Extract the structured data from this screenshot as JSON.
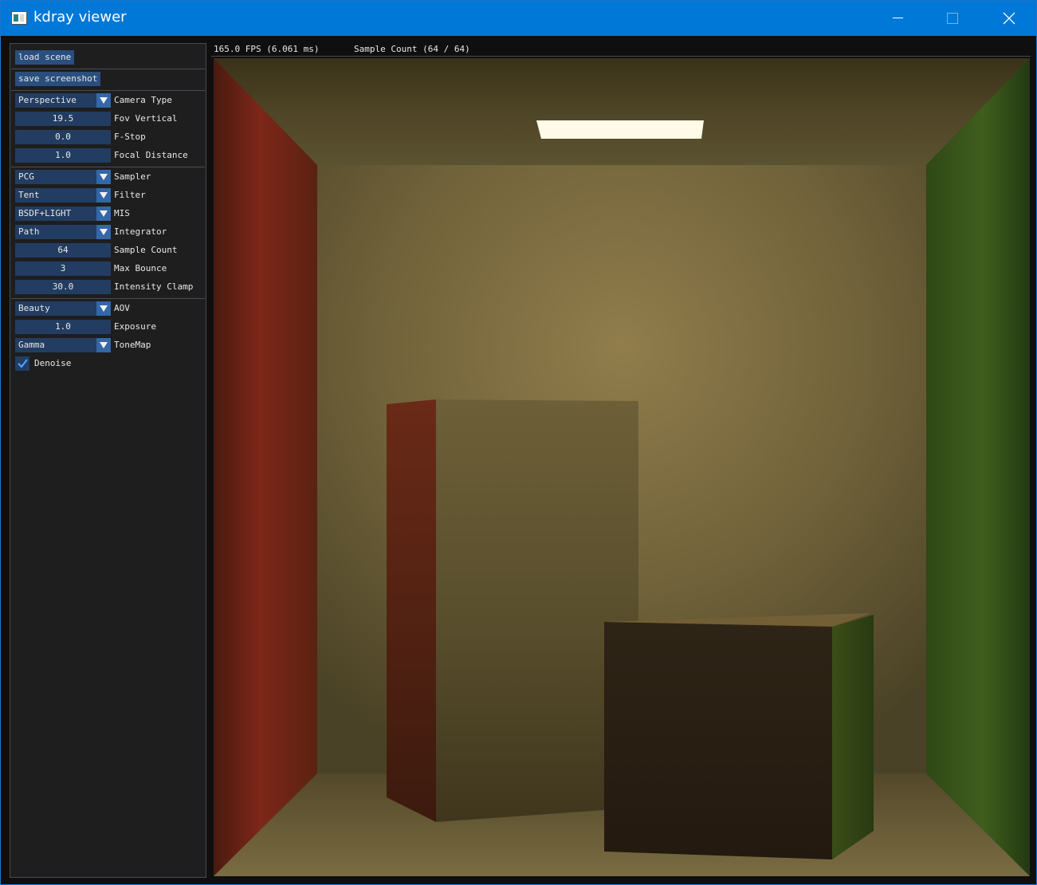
{
  "window": {
    "title": "kdray viewer"
  },
  "settings": {
    "load_scene": "load scene",
    "save_screenshot": "save screenshot",
    "camera": [
      {
        "kind": "combo",
        "value": "Perspective",
        "label": "Camera Type"
      },
      {
        "kind": "number",
        "value": "19.5",
        "label": "Fov Vertical"
      },
      {
        "kind": "number",
        "value": "0.0",
        "label": "F-Stop"
      },
      {
        "kind": "number",
        "value": "1.0",
        "label": "Focal Distance"
      }
    ],
    "render": [
      {
        "kind": "combo",
        "value": "PCG",
        "label": "Sampler"
      },
      {
        "kind": "combo",
        "value": "Tent",
        "label": "Filter"
      },
      {
        "kind": "combo",
        "value": "BSDF+LIGHT",
        "label": "MIS"
      },
      {
        "kind": "combo",
        "value": "Path",
        "label": "Integrator"
      },
      {
        "kind": "number",
        "value": "64",
        "label": "Sample Count"
      },
      {
        "kind": "number",
        "value": "3",
        "label": "Max Bounce"
      },
      {
        "kind": "number",
        "value": "30.0",
        "label": "Intensity Clamp"
      }
    ],
    "output": [
      {
        "kind": "combo",
        "value": "Beauty",
        "label": "AOV"
      },
      {
        "kind": "number",
        "value": "1.0",
        "label": "Exposure"
      },
      {
        "kind": "combo",
        "value": "Gamma",
        "label": "ToneMap"
      }
    ],
    "denoise": {
      "label": "Denoise",
      "checked": true
    }
  },
  "stats": {
    "fps": "165.0 FPS (6.061 ms)",
    "sample_count": "Sample Count (64 / 64)"
  },
  "colors": {
    "titlebar": "#0078d7",
    "panel_bg": "#1e1e1e",
    "control_bg": "#223d61",
    "button_bg": "#2a4f7e",
    "accent": "#3367a8",
    "left_wall": "#8a2a1c",
    "right_wall": "#3f5e1e",
    "back_wall": "#6e6238"
  }
}
